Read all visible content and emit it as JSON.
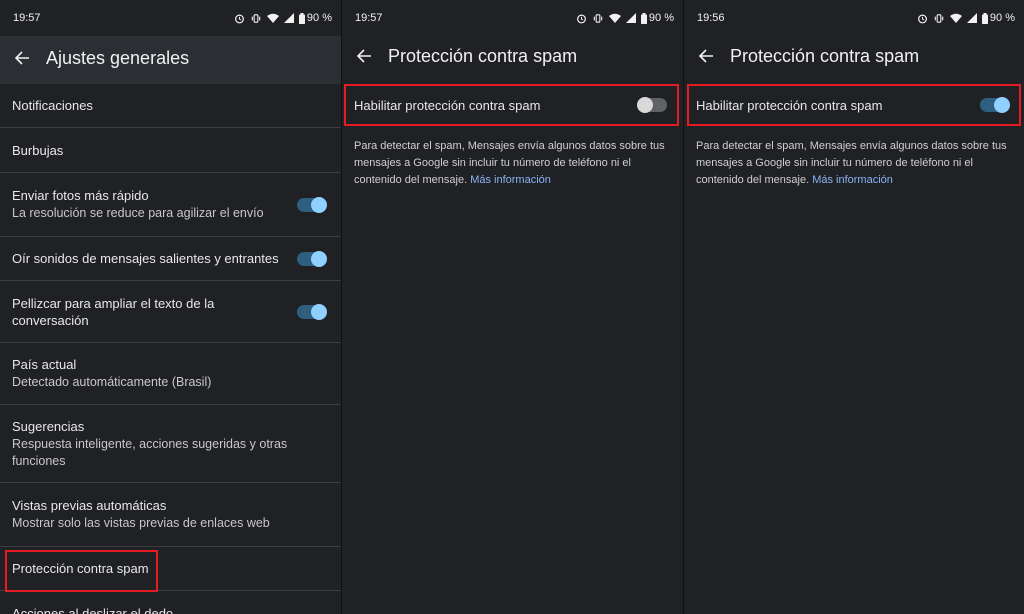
{
  "screens": [
    {
      "status": {
        "time": "19:57",
        "battery": "90 %"
      },
      "title": "Ajustes generales",
      "items": [
        {
          "primary": "Notificaciones"
        },
        {
          "primary": "Burbujas"
        },
        {
          "primary": "Enviar fotos más rápido",
          "secondary": "La resolución se reduce para agilizar el envío",
          "toggle": "on"
        },
        {
          "primary": "Oír sonidos de mensajes salientes y entrantes",
          "toggle": "on"
        },
        {
          "primary": "Pellizcar para ampliar el texto de la conversación",
          "toggle": "on"
        },
        {
          "primary": "País actual",
          "secondary": "Detectado automáticamente (Brasil)"
        },
        {
          "primary": "Sugerencias",
          "secondary": "Respuesta inteligente, acciones sugeridas y otras funciones"
        },
        {
          "primary": "Vistas previas automáticas",
          "secondary": "Mostrar solo las vistas previas de enlaces web"
        },
        {
          "primary": "Protección contra spam"
        },
        {
          "primary": "Acciones al deslizar el dedo"
        }
      ]
    },
    {
      "status": {
        "time": "19:57",
        "battery": "90 %"
      },
      "title": "Protección contra spam",
      "toggle_label": "Habilitar protección contra spam",
      "toggle_state": "off",
      "description": "Para detectar el spam, Mensajes envía algunos datos sobre tus mensajes a Google sin incluir tu número de teléfono ni el contenido del mensaje. ",
      "link": "Más información"
    },
    {
      "status": {
        "time": "19:56",
        "battery": "90 %"
      },
      "title": "Protección contra spam",
      "toggle_label": "Habilitar protección contra spam",
      "toggle_state": "on",
      "description": "Para detectar el spam, Mensajes envía algunos datos sobre tus mensajes a Google sin incluir tu número de teléfono ni el contenido del mensaje. ",
      "link": "Más información"
    }
  ],
  "icons": [
    "alarm-icon",
    "vibrate-icon",
    "wifi-icon",
    "signal-icon",
    "battery-icon",
    "back-arrow-icon"
  ],
  "colors": {
    "background": "#202124",
    "accent": "#8fd0ff",
    "highlight": "#e41c24",
    "link": "#8ab4f8"
  }
}
